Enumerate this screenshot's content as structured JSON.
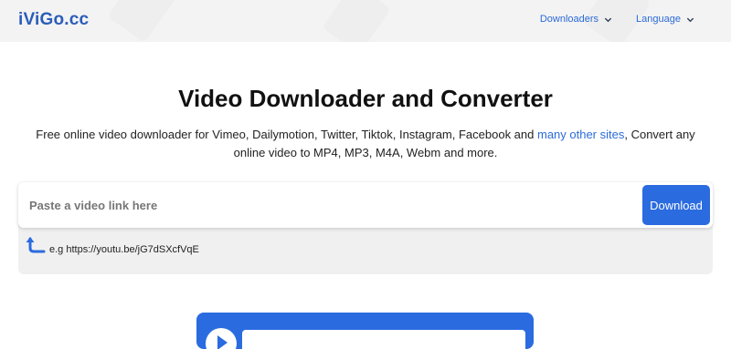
{
  "header": {
    "logo": "iViGo.cc",
    "nav": [
      {
        "label": "Downloaders"
      },
      {
        "label": "Language"
      }
    ]
  },
  "hero": {
    "title": "Video Downloader and Converter",
    "subtitle_before": "Free online video downloader for Vimeo, Dailymotion, Twitter, Tiktok, Instagram, Facebook and ",
    "subtitle_link": "many other sites",
    "subtitle_after": ", Convert any online video to MP4, MP3, M4A, Webm and more."
  },
  "search": {
    "placeholder": "Paste a video link here",
    "value": "",
    "button_label": "Download",
    "example": "e.g https://youtu.be/jG7dSXcfVqE"
  },
  "colors": {
    "accent": "#2b6be0",
    "logo": "#2a5db8",
    "panel_bg": "#f0f0f0",
    "header_bg": "#f3f3f3"
  },
  "icons": [
    "chevron-down-icon",
    "return-arrow-icon",
    "play-icon"
  ]
}
